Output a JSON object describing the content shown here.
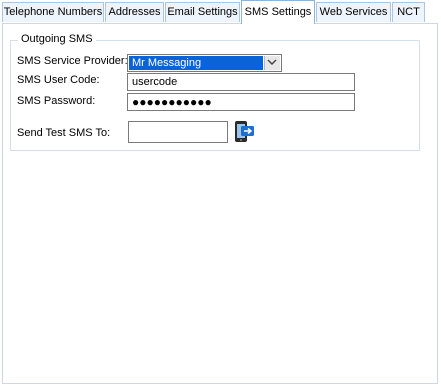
{
  "tabs": [
    {
      "label": "Telephone Numbers"
    },
    {
      "label": "Addresses"
    },
    {
      "label": "Email Settings"
    },
    {
      "label": "SMS Settings"
    },
    {
      "label": "Web Services"
    },
    {
      "label": "NCT"
    }
  ],
  "group": {
    "title": "Outgoing SMS",
    "provider_label": "SMS Service Provider:",
    "provider_value": "Mr Messaging",
    "user_code_label": "SMS User Code:",
    "user_code_value": "usercode",
    "password_label": "SMS Password:",
    "password_value": "●●●●●●●●●●●",
    "test_label": "Send Test SMS To:",
    "test_value": ""
  },
  "icons": {
    "send_test": "phone-send-icon",
    "dropdown": "chevron-down-icon"
  },
  "colors": {
    "selection": "#0a64d8",
    "tab_border": "#a9c7e0",
    "icon_blue": "#1f6fd1"
  }
}
